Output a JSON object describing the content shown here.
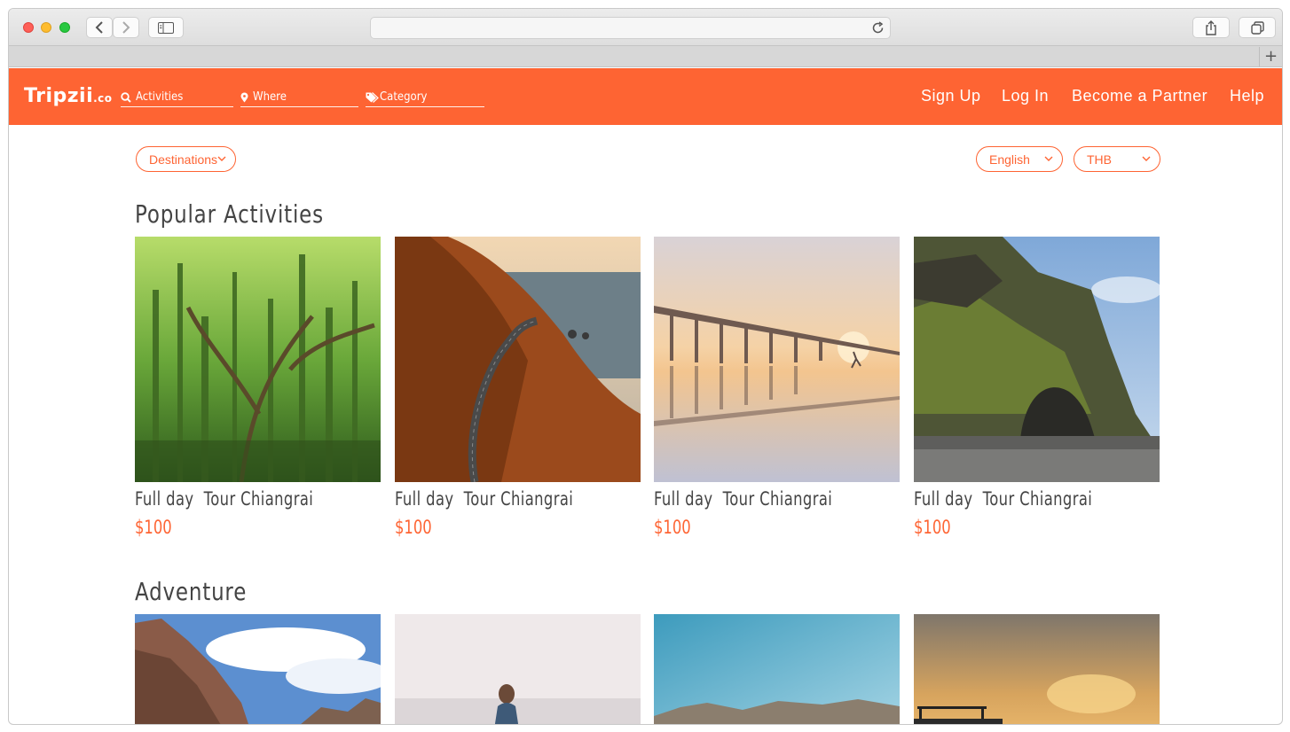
{
  "browser": {
    "url": ""
  },
  "nav": {
    "logo_main": "Tripzii",
    "logo_suffix": ".co",
    "search_activities": "Activities",
    "search_where": "Where",
    "search_category": "Category",
    "links": [
      "Sign Up",
      "Log In",
      "Become a Partner",
      "Help"
    ]
  },
  "filters": {
    "destinations": "Destinations",
    "language": "English",
    "currency": "THB"
  },
  "sections": [
    {
      "title": "Popular Activities",
      "cards": [
        {
          "title": "Full day  Tour Chiangrai",
          "price": "$100",
          "image": "bamboo-forest"
        },
        {
          "title": "Full day  Tour Chiangrai",
          "price": "$100",
          "image": "coastal-road"
        },
        {
          "title": "Full day  Tour Chiangrai",
          "price": "$100",
          "image": "pier-sunset"
        },
        {
          "title": "Full day  Tour Chiangrai",
          "price": "$100",
          "image": "sea-cliff"
        }
      ]
    },
    {
      "title": "Adventure",
      "cards": [
        {
          "image": "canyon-sky"
        },
        {
          "image": "beach-girl"
        },
        {
          "image": "blue-sky-hills"
        },
        {
          "image": "sunset-jeep"
        }
      ]
    }
  ],
  "colors": {
    "brand": "#fe6433",
    "text": "#444444"
  }
}
